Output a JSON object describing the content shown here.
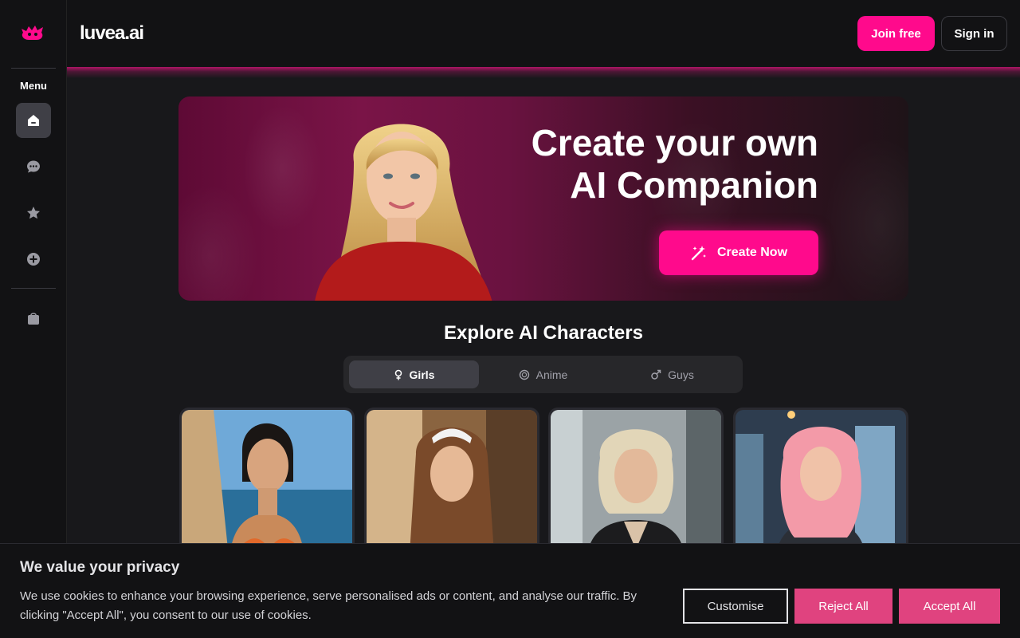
{
  "brand": {
    "name": "luvea.ai",
    "accent": "#ff0a8c"
  },
  "sidebar": {
    "menu_label": "Menu",
    "items": [
      {
        "icon": "home-icon",
        "active": true
      },
      {
        "icon": "chat-icon",
        "active": false
      },
      {
        "icon": "star-icon",
        "active": false
      },
      {
        "icon": "plus-circle-icon",
        "active": false
      },
      {
        "icon": "shopping-bag-icon",
        "active": false
      }
    ]
  },
  "header": {
    "join_label": "Join free",
    "signin_label": "Sign in"
  },
  "hero": {
    "title_line1": "Create your own",
    "title_line2": "AI Companion",
    "cta_label": "Create Now"
  },
  "explore": {
    "title": "Explore AI Characters",
    "tabs": [
      {
        "label": "Girls",
        "icon": "female-icon",
        "active": true
      },
      {
        "label": "Anime",
        "icon": "anime-icon",
        "active": false
      },
      {
        "label": "Guys",
        "icon": "male-icon",
        "active": false
      }
    ]
  },
  "cookie": {
    "title": "We value your privacy",
    "text": "We use cookies to enhance your browsing experience, serve personalised ads or content, and analyse our traffic. By clicking \"Accept All\", you consent to our use of cookies.",
    "customise_label": "Customise",
    "reject_label": "Reject All",
    "accept_label": "Accept All"
  }
}
